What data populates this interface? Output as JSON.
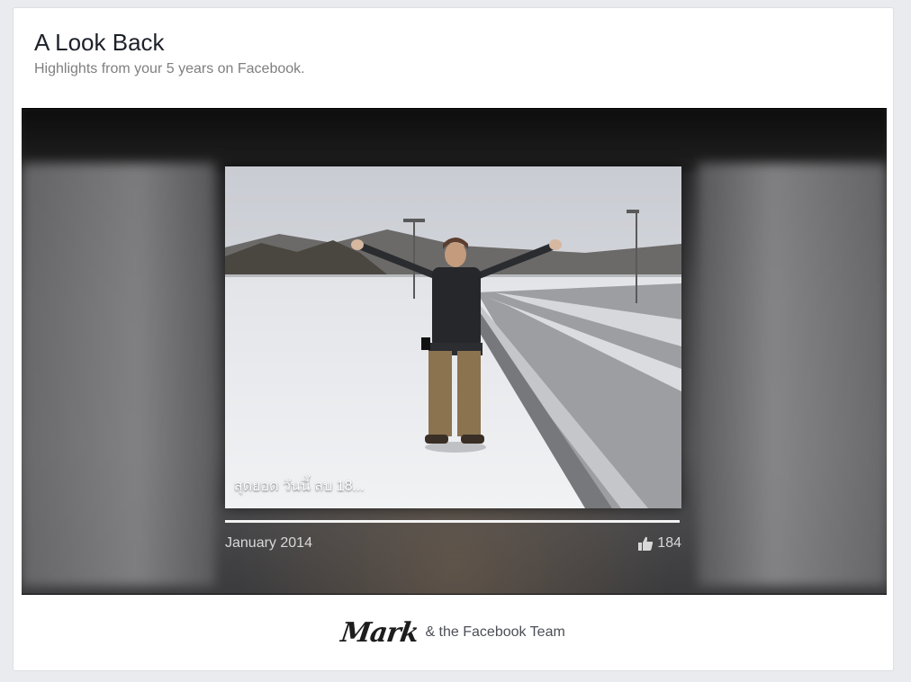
{
  "header": {
    "title": "A Look Back",
    "subtitle": "Highlights from your 5 years on Facebook."
  },
  "video": {
    "caption": "สุดยอด วันนี้ ลบ 18...",
    "date": "January 2014",
    "likes": "184",
    "progress": 1.0
  },
  "footer": {
    "signature": "Mark",
    "signoff": "& the Facebook Team"
  },
  "icons": {
    "like": "thumbs-up-icon"
  },
  "colors": {
    "page_bg": "#e9ebee",
    "card_bg": "#ffffff",
    "title": "#1d2129",
    "subtitle": "#7f7f7f"
  }
}
